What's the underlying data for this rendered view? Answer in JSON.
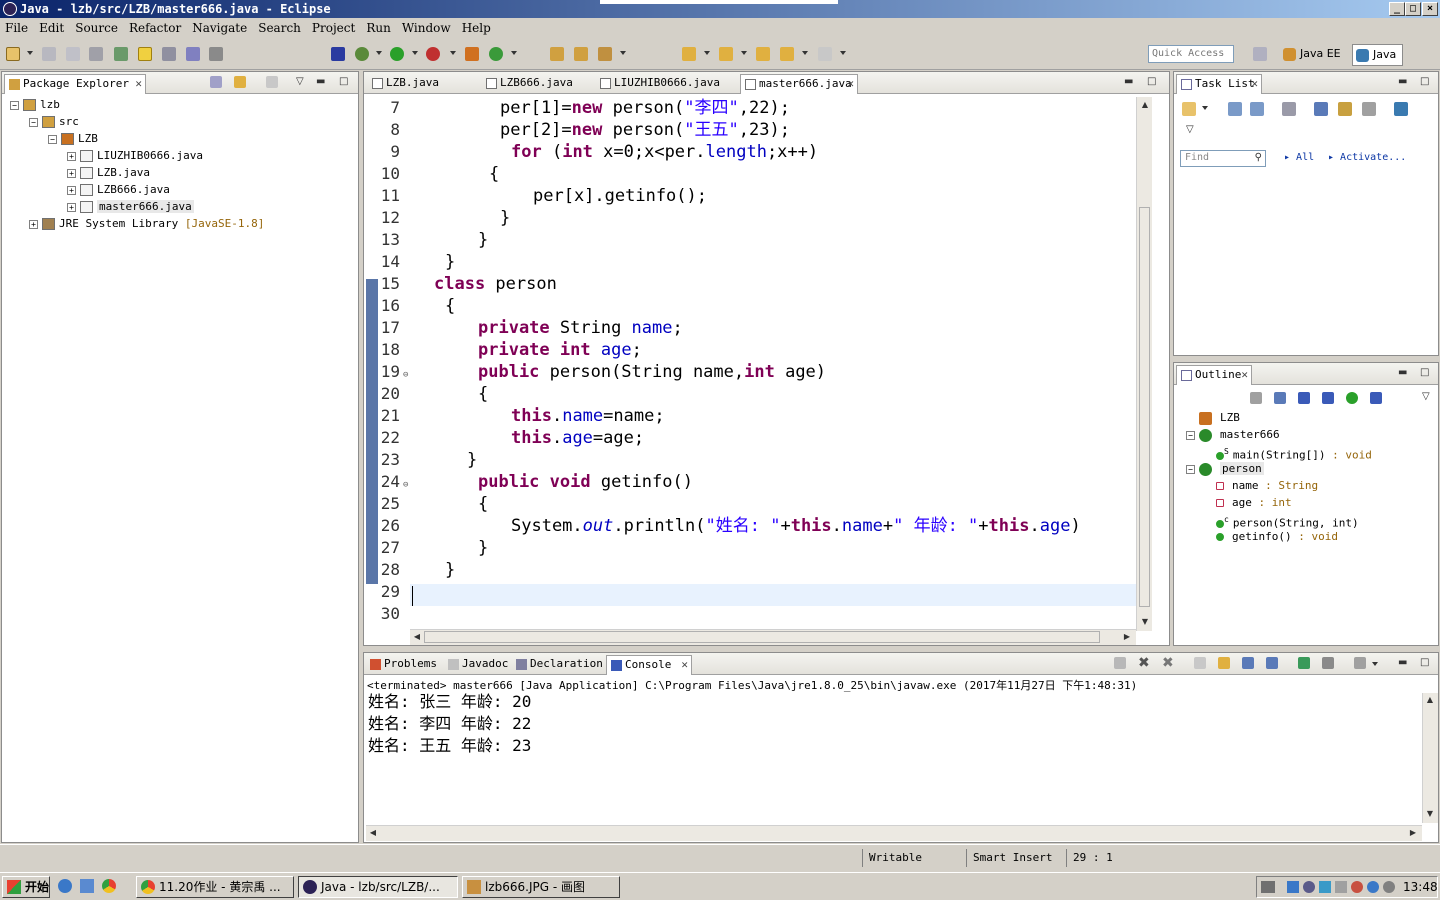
{
  "window": {
    "title": "Java - lzb/src/LZB/master666.java - Eclipse"
  },
  "menu": [
    "File",
    "Edit",
    "Source",
    "Refactor",
    "Navigate",
    "Search",
    "Project",
    "Run",
    "Window",
    "Help"
  ],
  "toolbar": {
    "quick_access_placeholder": "Quick Access",
    "perspectives": [
      "Java EE",
      "Java"
    ]
  },
  "package_explorer": {
    "tab_label": "Package Explorer",
    "tree": [
      {
        "label": "lzb",
        "level": 0,
        "icon": "project-icon",
        "expander": "−"
      },
      {
        "label": "src",
        "level": 1,
        "icon": "source-folder-icon",
        "expander": "−"
      },
      {
        "label": "LZB",
        "level": 2,
        "icon": "package-icon",
        "expander": "−"
      },
      {
        "label": "LIUZHIB0666.java",
        "level": 3,
        "icon": "java-file-icon",
        "expander": "+"
      },
      {
        "label": "LZB.java",
        "level": 3,
        "icon": "java-file-icon",
        "expander": "+"
      },
      {
        "label": "LZB666.java",
        "level": 3,
        "icon": "java-file-icon",
        "expander": "+"
      },
      {
        "label": "master666.java",
        "level": 3,
        "icon": "java-file-icon",
        "expander": "+",
        "selected": true
      },
      {
        "label": "JRE System Library",
        "suffix": "[JavaSE-1.8]",
        "level": 1,
        "icon": "library-icon",
        "expander": "+"
      }
    ]
  },
  "editor": {
    "tabs": [
      "LZB.java",
      "LZB666.java",
      "LIUZHIB0666.java",
      "master666.java"
    ],
    "active_tab": "master666.java",
    "lines": [
      {
        "n": "7",
        "indent": 8,
        "tokens": [
          [
            "",
            "per[1]="
          ],
          [
            "kw",
            "new"
          ],
          [
            "",
            " person("
          ],
          [
            "str",
            "\"李四\""
          ],
          [
            "",
            ",22);"
          ]
        ]
      },
      {
        "n": "8",
        "indent": 8,
        "tokens": [
          [
            "",
            "per[2]="
          ],
          [
            "kw",
            "new"
          ],
          [
            "",
            " person("
          ],
          [
            "str",
            "\"王五\""
          ],
          [
            "",
            ",23);"
          ]
        ]
      },
      {
        "n": "9",
        "indent": 9,
        "tokens": [
          [
            "kw",
            "for"
          ],
          [
            "",
            " ("
          ],
          [
            "kw",
            "int"
          ],
          [
            "",
            " x=0;x<per."
          ],
          [
            "fld",
            "length"
          ],
          [
            "",
            ";x++)"
          ]
        ]
      },
      {
        "n": "10",
        "indent": 7,
        "tokens": [
          [
            "",
            "{"
          ]
        ]
      },
      {
        "n": "11",
        "indent": 11,
        "tokens": [
          [
            "",
            "per[x].getinfo();"
          ]
        ]
      },
      {
        "n": "12",
        "indent": 8,
        "tokens": [
          [
            "",
            "}"
          ]
        ]
      },
      {
        "n": "13",
        "indent": 6,
        "tokens": [
          [
            "",
            "}"
          ]
        ]
      },
      {
        "n": "14",
        "indent": 3,
        "tokens": [
          [
            "",
            "}"
          ]
        ]
      },
      {
        "n": "15",
        "indent": 2,
        "tokens": [
          [
            "kw",
            "class"
          ],
          [
            "",
            " person"
          ]
        ]
      },
      {
        "n": "16",
        "indent": 3,
        "tokens": [
          [
            "",
            "{"
          ]
        ]
      },
      {
        "n": "17",
        "indent": 6,
        "tokens": [
          [
            "kw",
            "private"
          ],
          [
            "",
            " String "
          ],
          [
            "fld",
            "name"
          ],
          [
            "",
            ";"
          ]
        ]
      },
      {
        "n": "18",
        "indent": 6,
        "tokens": [
          [
            "kw",
            "private"
          ],
          [
            "",
            " "
          ],
          [
            "kw",
            "int"
          ],
          [
            "",
            " "
          ],
          [
            "fld",
            "age"
          ],
          [
            "",
            ";"
          ]
        ]
      },
      {
        "n": "19",
        "indent": 6,
        "tokens": [
          [
            "kw",
            "public"
          ],
          [
            "",
            " person(String name,"
          ],
          [
            "kw",
            "int"
          ],
          [
            "",
            " age)"
          ]
        ]
      },
      {
        "n": "20",
        "indent": 6,
        "tokens": [
          [
            "",
            "{"
          ]
        ]
      },
      {
        "n": "21",
        "indent": 9,
        "tokens": [
          [
            "kw",
            "this"
          ],
          [
            "",
            "."
          ],
          [
            "fld",
            "name"
          ],
          [
            "",
            "=name;"
          ]
        ]
      },
      {
        "n": "22",
        "indent": 9,
        "tokens": [
          [
            "kw",
            "this"
          ],
          [
            "",
            "."
          ],
          [
            "fld",
            "age"
          ],
          [
            "",
            "=age;"
          ]
        ]
      },
      {
        "n": "23",
        "indent": 5,
        "tokens": [
          [
            "",
            "}"
          ]
        ]
      },
      {
        "n": "24",
        "indent": 6,
        "tokens": [
          [
            "kw",
            "public"
          ],
          [
            "",
            " "
          ],
          [
            "kw",
            "void"
          ],
          [
            "",
            " getinfo()"
          ]
        ]
      },
      {
        "n": "25",
        "indent": 6,
        "tokens": [
          [
            "",
            "{"
          ]
        ]
      },
      {
        "n": "26",
        "indent": 9,
        "tokens": [
          [
            "",
            "System."
          ],
          [
            "sfld",
            "out"
          ],
          [
            "",
            ".println("
          ],
          [
            "str",
            "\"姓名: \""
          ],
          [
            "",
            "+"
          ],
          [
            "kw",
            "this"
          ],
          [
            "",
            "."
          ],
          [
            "fld",
            "name"
          ],
          [
            "",
            "+"
          ],
          [
            "str",
            "\" 年龄: \""
          ],
          [
            "",
            "+"
          ],
          [
            "kw",
            "this"
          ],
          [
            "",
            "."
          ],
          [
            "fld",
            "age"
          ],
          [
            "",
            ")"
          ]
        ]
      },
      {
        "n": "27",
        "indent": 6,
        "tokens": [
          [
            "",
            "}"
          ]
        ]
      },
      {
        "n": "28",
        "indent": 3,
        "tokens": [
          [
            "",
            "}"
          ]
        ]
      },
      {
        "n": "29",
        "indent": 0,
        "tokens": [
          [
            "",
            ""
          ]
        ],
        "current": true
      },
      {
        "n": "30",
        "indent": 0,
        "tokens": [
          [
            "",
            ""
          ]
        ]
      }
    ]
  },
  "task_list": {
    "tab_label": "Task List",
    "find_placeholder": "Find",
    "filter_all": "All",
    "filter_activate": "Activate..."
  },
  "outline": {
    "tab_label": "Outline",
    "items": [
      {
        "label": "LZB",
        "type": "",
        "level": 0,
        "icon": "package-icon"
      },
      {
        "label": "master666",
        "type": "",
        "level": 0,
        "icon": "class-icon",
        "expander": "−"
      },
      {
        "label": "main(String[])",
        "type": " : void",
        "level": 1,
        "icon": "public-method-icon",
        "static": "S"
      },
      {
        "label": "person",
        "type": "",
        "level": 0,
        "icon": "class-icon",
        "expander": "−",
        "selected": true
      },
      {
        "label": "name",
        "type": " : String",
        "level": 1,
        "icon": "private-field-icon"
      },
      {
        "label": "age",
        "type": " : int",
        "level": 1,
        "icon": "private-field-icon"
      },
      {
        "label": "person(String, int)",
        "type": "",
        "level": 1,
        "icon": "constructor-icon",
        "static": "c"
      },
      {
        "label": "getinfo()",
        "type": " : void",
        "level": 1,
        "icon": "public-method-icon"
      }
    ]
  },
  "console": {
    "tabs": [
      "Problems",
      "Javadoc",
      "Declaration",
      "Console"
    ],
    "active_tab": "Console",
    "header": "<terminated> master666 [Java Application] C:\\Program Files\\Java\\jre1.8.0_25\\bin\\javaw.exe (2017年11月27日 下午1:48:31)",
    "output": [
      "姓名: 张三 年龄: 20",
      "姓名: 李四 年龄: 22",
      "姓名: 王五 年龄: 23"
    ]
  },
  "status": {
    "writable": "Writable",
    "insert_mode": "Smart Insert",
    "position": "29 : 1"
  },
  "taskbar": {
    "start_label": "开始",
    "buttons": [
      "11.20作业 - 黄宗禹 ...",
      "Java - lzb/src/LZB/...",
      "lzb666.JPG - 画图"
    ],
    "active_index": 1,
    "clock": "13:48"
  },
  "colors": {
    "keyword": "#7f0055",
    "field": "#0000c0",
    "string": "#2a00ff",
    "titlebar": "#0a246a"
  }
}
